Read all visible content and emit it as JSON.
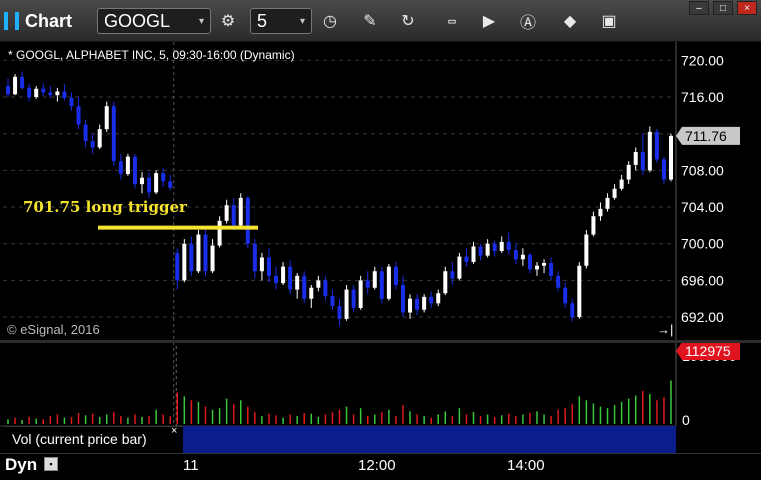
{
  "window": {
    "title": "Chart",
    "controls": [
      "–",
      "□",
      "×"
    ]
  },
  "toolbar": {
    "symbol": "GOOGL",
    "interval": "5",
    "icons": [
      "symbol-settings-icon",
      "clock-icon",
      "pencil-icon",
      "refresh-icon",
      "get-data-icon",
      "play-icon",
      "alert-icon",
      "cursor-icon",
      "camera-icon"
    ]
  },
  "chart": {
    "info": "* GOOGL, ALPHABET INC, 5, 09:30-16:00 (Dynamic)",
    "copyright": "© eSignal, 2016",
    "annotation_text": "701.75 long trigger",
    "last_price_tag": "711.76",
    "volume_tag": "112975",
    "volume_axis_top": "1000000",
    "volume_axis_zero": "0",
    "volume_legend": "Vol (current price bar)",
    "volume_legend_close": "×",
    "dyn_label": "Dyn",
    "time_labels": [
      "11",
      "12:00",
      "14:00"
    ],
    "colors": {
      "up": "#ffffff",
      "down": "#1a2de8",
      "annotation": "#f5e32e",
      "last_tag": "#c8c8c8",
      "volume_tag": "#e0141e",
      "vol_up": "#3cc83c",
      "vol_down": "#e01a1a"
    }
  },
  "chart_data": {
    "type": "candlestick",
    "y_ticks": [
      "720.00",
      "716.00",
      "712.00",
      "708.00",
      "704.00",
      "700.00",
      "696.00",
      "692.00"
    ],
    "ylim": [
      689.5,
      722
    ],
    "annotation_level": 701.75,
    "last_price": 711.76,
    "candles": [
      [
        717.2,
        718.0,
        716.0,
        716.3
      ],
      [
        716.3,
        718.5,
        716.2,
        718.2
      ],
      [
        718.2,
        718.8,
        716.8,
        717.0
      ],
      [
        717.0,
        717.5,
        715.5,
        716.0
      ],
      [
        716.0,
        717.2,
        715.8,
        716.9
      ],
      [
        716.9,
        717.5,
        716.1,
        716.5
      ],
      [
        716.5,
        717.2,
        715.9,
        716.2
      ],
      [
        716.2,
        717.0,
        715.5,
        716.6
      ],
      [
        716.6,
        717.4,
        715.6,
        715.9
      ],
      [
        715.9,
        716.5,
        714.5,
        715.0
      ],
      [
        715.0,
        716.0,
        712.5,
        713.0
      ],
      [
        713.0,
        713.5,
        710.5,
        711.2
      ],
      [
        711.2,
        712.0,
        709.8,
        710.5
      ],
      [
        710.5,
        713.0,
        710.3,
        712.5
      ],
      [
        712.5,
        715.5,
        712.2,
        715.0
      ],
      [
        715.0,
        715.5,
        708.5,
        709.0
      ],
      [
        709.0,
        709.8,
        707.0,
        707.6
      ],
      [
        707.6,
        709.8,
        707.4,
        709.5
      ],
      [
        709.5,
        709.8,
        706.0,
        706.5
      ],
      [
        706.5,
        707.8,
        705.5,
        707.2
      ],
      [
        707.2,
        707.8,
        705.0,
        705.6
      ],
      [
        705.6,
        708.0,
        705.4,
        707.7
      ],
      [
        707.7,
        708.3,
        706.2,
        706.8
      ],
      [
        706.8,
        707.5,
        705.8,
        706.1
      ],
      [
        699.0,
        699.5,
        695.0,
        696.0
      ],
      [
        696.0,
        700.5,
        695.8,
        700.0
      ],
      [
        700.0,
        700.8,
        696.5,
        697.0
      ],
      [
        697.0,
        701.5,
        696.8,
        701.0
      ],
      [
        701.0,
        701.8,
        696.5,
        697.0
      ],
      [
        697.0,
        700.5,
        696.8,
        699.8
      ],
      [
        699.8,
        703.0,
        699.6,
        702.5
      ],
      [
        702.5,
        704.8,
        702.2,
        704.2
      ],
      [
        704.2,
        705.0,
        701.5,
        702.0
      ],
      [
        702.0,
        705.5,
        701.8,
        705.0
      ],
      [
        705.0,
        705.2,
        699.5,
        700.0
      ],
      [
        700.0,
        700.5,
        696.2,
        697.0
      ],
      [
        697.0,
        699.0,
        696.0,
        698.5
      ],
      [
        698.5,
        699.5,
        695.8,
        696.5
      ],
      [
        696.5,
        697.5,
        695.0,
        695.7
      ],
      [
        695.7,
        698.0,
        695.5,
        697.5
      ],
      [
        697.5,
        698.2,
        694.5,
        695.0
      ],
      [
        695.0,
        696.8,
        694.0,
        696.5
      ],
      [
        696.5,
        697.0,
        693.5,
        694.0
      ],
      [
        694.0,
        695.5,
        693.0,
        695.2
      ],
      [
        695.2,
        696.5,
        694.8,
        696.0
      ],
      [
        696.0,
        696.5,
        693.8,
        694.3
      ],
      [
        694.3,
        695.0,
        692.8,
        693.2
      ],
      [
        693.2,
        694.0,
        691.0,
        691.8
      ],
      [
        691.8,
        695.5,
        691.6,
        695.0
      ],
      [
        695.0,
        695.5,
        692.5,
        693.0
      ],
      [
        693.0,
        696.5,
        692.8,
        696.0
      ],
      [
        696.0,
        697.0,
        694.5,
        695.2
      ],
      [
        695.2,
        697.5,
        695.0,
        697.0
      ],
      [
        697.0,
        697.5,
        693.5,
        694.0
      ],
      [
        694.0,
        697.8,
        693.8,
        697.5
      ],
      [
        697.5,
        698.0,
        695.0,
        695.5
      ],
      [
        695.5,
        696.5,
        692.0,
        692.5
      ],
      [
        692.5,
        694.5,
        691.8,
        694.0
      ],
      [
        694.0,
        694.5,
        692.2,
        692.8
      ],
      [
        692.8,
        694.5,
        692.5,
        694.2
      ],
      [
        694.2,
        694.8,
        693.0,
        693.5
      ],
      [
        693.5,
        695.0,
        693.2,
        694.6
      ],
      [
        694.6,
        697.5,
        694.4,
        697.0
      ],
      [
        697.0,
        698.0,
        695.5,
        696.2
      ],
      [
        696.2,
        699.0,
        696.0,
        698.6
      ],
      [
        698.6,
        699.5,
        697.5,
        698.0
      ],
      [
        698.0,
        700.2,
        697.8,
        699.7
      ],
      [
        699.7,
        700.0,
        698.2,
        698.7
      ],
      [
        698.7,
        700.5,
        698.5,
        700.0
      ],
      [
        700.0,
        700.3,
        698.6,
        699.2
      ],
      [
        699.2,
        700.8,
        699.0,
        700.2
      ],
      [
        700.2,
        701.2,
        698.8,
        699.3
      ],
      [
        699.3,
        700.0,
        697.8,
        698.3
      ],
      [
        698.3,
        699.5,
        697.6,
        698.8
      ],
      [
        698.8,
        699.0,
        696.8,
        697.2
      ],
      [
        697.2,
        698.0,
        696.5,
        697.6
      ],
      [
        697.6,
        698.3,
        696.8,
        697.9
      ],
      [
        697.9,
        698.5,
        696.0,
        696.5
      ],
      [
        696.5,
        697.0,
        694.8,
        695.2
      ],
      [
        695.2,
        695.8,
        693.0,
        693.5
      ],
      [
        693.5,
        694.0,
        691.5,
        692.0
      ],
      [
        692.0,
        698.0,
        691.8,
        697.6
      ],
      [
        697.6,
        701.5,
        697.3,
        701.0
      ],
      [
        701.0,
        703.5,
        700.8,
        703.0
      ],
      [
        703.0,
        704.5,
        702.5,
        703.8
      ],
      [
        703.8,
        705.5,
        703.5,
        705.0
      ],
      [
        705.0,
        706.5,
        704.8,
        706.0
      ],
      [
        706.0,
        707.5,
        705.8,
        707.0
      ],
      [
        707.0,
        709.0,
        706.5,
        708.6
      ],
      [
        708.6,
        710.5,
        708.0,
        710.0
      ],
      [
        710.0,
        712.0,
        707.5,
        708.0
      ],
      [
        708.0,
        712.8,
        707.8,
        712.2
      ],
      [
        712.2,
        712.5,
        708.8,
        709.2
      ],
      [
        709.2,
        709.5,
        706.5,
        707.0
      ],
      [
        707.0,
        712.0,
        706.8,
        711.76
      ]
    ],
    "volume": [
      {
        "v": 0.06,
        "up": true
      },
      {
        "v": 0.08,
        "up": false
      },
      {
        "v": 0.05,
        "up": true
      },
      {
        "v": 0.09,
        "up": false
      },
      {
        "v": 0.07,
        "up": true
      },
      {
        "v": 0.06,
        "up": false
      },
      {
        "v": 0.1,
        "up": false
      },
      {
        "v": 0.12,
        "up": false
      },
      {
        "v": 0.08,
        "up": true
      },
      {
        "v": 0.09,
        "up": false
      },
      {
        "v": 0.14,
        "up": false
      },
      {
        "v": 0.11,
        "up": true
      },
      {
        "v": 0.13,
        "up": false
      },
      {
        "v": 0.09,
        "up": true
      },
      {
        "v": 0.12,
        "up": true
      },
      {
        "v": 0.15,
        "up": false
      },
      {
        "v": 0.1,
        "up": false
      },
      {
        "v": 0.08,
        "up": true
      },
      {
        "v": 0.12,
        "up": false
      },
      {
        "v": 0.09,
        "up": true
      },
      {
        "v": 0.1,
        "up": false
      },
      {
        "v": 0.18,
        "up": true
      },
      {
        "v": 0.12,
        "up": false
      },
      {
        "v": 0.1,
        "up": false
      },
      {
        "v": 0.4,
        "up": false
      },
      {
        "v": 0.35,
        "up": true
      },
      {
        "v": 0.3,
        "up": false
      },
      {
        "v": 0.28,
        "up": true
      },
      {
        "v": 0.22,
        "up": false
      },
      {
        "v": 0.18,
        "up": true
      },
      {
        "v": 0.2,
        "up": true
      },
      {
        "v": 0.32,
        "up": true
      },
      {
        "v": 0.25,
        "up": false
      },
      {
        "v": 0.3,
        "up": true
      },
      {
        "v": 0.22,
        "up": false
      },
      {
        "v": 0.15,
        "up": false
      },
      {
        "v": 0.1,
        "up": true
      },
      {
        "v": 0.13,
        "up": false
      },
      {
        "v": 0.11,
        "up": false
      },
      {
        "v": 0.08,
        "up": true
      },
      {
        "v": 0.12,
        "up": false
      },
      {
        "v": 0.1,
        "up": true
      },
      {
        "v": 0.14,
        "up": false
      },
      {
        "v": 0.13,
        "up": true
      },
      {
        "v": 0.09,
        "up": true
      },
      {
        "v": 0.12,
        "up": false
      },
      {
        "v": 0.15,
        "up": false
      },
      {
        "v": 0.18,
        "up": false
      },
      {
        "v": 0.22,
        "up": true
      },
      {
        "v": 0.12,
        "up": false
      },
      {
        "v": 0.2,
        "up": true
      },
      {
        "v": 0.1,
        "up": false
      },
      {
        "v": 0.12,
        "up": true
      },
      {
        "v": 0.15,
        "up": false
      },
      {
        "v": 0.18,
        "up": true
      },
      {
        "v": 0.1,
        "up": false
      },
      {
        "v": 0.24,
        "up": false
      },
      {
        "v": 0.16,
        "up": true
      },
      {
        "v": 0.12,
        "up": false
      },
      {
        "v": 0.1,
        "up": true
      },
      {
        "v": 0.08,
        "up": false
      },
      {
        "v": 0.12,
        "up": true
      },
      {
        "v": 0.16,
        "up": true
      },
      {
        "v": 0.1,
        "up": false
      },
      {
        "v": 0.2,
        "up": true
      },
      {
        "v": 0.12,
        "up": false
      },
      {
        "v": 0.15,
        "up": true
      },
      {
        "v": 0.1,
        "up": false
      },
      {
        "v": 0.12,
        "up": true
      },
      {
        "v": 0.09,
        "up": false
      },
      {
        "v": 0.11,
        "up": true
      },
      {
        "v": 0.13,
        "up": false
      },
      {
        "v": 0.1,
        "up": false
      },
      {
        "v": 0.12,
        "up": true
      },
      {
        "v": 0.14,
        "up": false
      },
      {
        "v": 0.16,
        "up": true
      },
      {
        "v": 0.12,
        "up": true
      },
      {
        "v": 0.1,
        "up": false
      },
      {
        "v": 0.18,
        "up": false
      },
      {
        "v": 0.2,
        "up": false
      },
      {
        "v": 0.25,
        "up": false
      },
      {
        "v": 0.35,
        "up": true
      },
      {
        "v": 0.3,
        "up": true
      },
      {
        "v": 0.26,
        "up": true
      },
      {
        "v": 0.22,
        "up": true
      },
      {
        "v": 0.2,
        "up": true
      },
      {
        "v": 0.24,
        "up": true
      },
      {
        "v": 0.28,
        "up": true
      },
      {
        "v": 0.32,
        "up": true
      },
      {
        "v": 0.36,
        "up": true
      },
      {
        "v": 0.42,
        "up": false
      },
      {
        "v": 0.38,
        "up": true
      },
      {
        "v": 0.3,
        "up": false
      },
      {
        "v": 0.34,
        "up": false
      },
      {
        "v": 0.55,
        "up": true
      }
    ]
  }
}
